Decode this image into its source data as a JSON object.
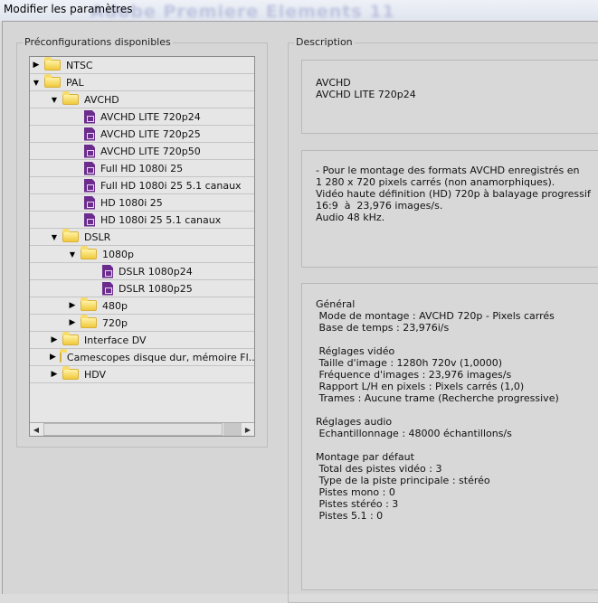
{
  "window": {
    "title": "Modifier les paramètres",
    "background_title": "Adobe Premiere Elements 11"
  },
  "presets": {
    "legend": "Préconfigurations disponibles",
    "items": [
      {
        "label": "NTSC",
        "level": 0,
        "type": "folder",
        "state": "collapsed"
      },
      {
        "label": "PAL",
        "level": 0,
        "type": "folder",
        "state": "expanded"
      },
      {
        "label": "AVCHD",
        "level": 1,
        "type": "folder",
        "state": "expanded"
      },
      {
        "label": "AVCHD LITE 720p24",
        "level": 2,
        "type": "preset"
      },
      {
        "label": "AVCHD LITE 720p25",
        "level": 2,
        "type": "preset"
      },
      {
        "label": "AVCHD LITE 720p50",
        "level": 2,
        "type": "preset"
      },
      {
        "label": "Full HD 1080i 25",
        "level": 2,
        "type": "preset"
      },
      {
        "label": "Full HD 1080i 25 5.1 canaux",
        "level": 2,
        "type": "preset"
      },
      {
        "label": "HD 1080i 25",
        "level": 2,
        "type": "preset"
      },
      {
        "label": "HD 1080i 25 5.1 canaux",
        "level": 2,
        "type": "preset"
      },
      {
        "label": "DSLR",
        "level": 1,
        "type": "folder",
        "state": "expanded"
      },
      {
        "label": "1080p",
        "level": 2,
        "type": "folder",
        "state": "expanded"
      },
      {
        "label": "DSLR 1080p24",
        "level": 3,
        "type": "preset"
      },
      {
        "label": "DSLR 1080p25",
        "level": 3,
        "type": "preset"
      },
      {
        "label": "480p",
        "level": 2,
        "type": "folder",
        "state": "collapsed"
      },
      {
        "label": "720p",
        "level": 2,
        "type": "folder",
        "state": "collapsed"
      },
      {
        "label": "Interface DV",
        "level": 1,
        "type": "folder",
        "state": "collapsed"
      },
      {
        "label": "Camescopes disque dur, mémoire Fl...",
        "level": 1,
        "type": "folder",
        "state": "collapsed"
      },
      {
        "label": "HDV",
        "level": 1,
        "type": "folder",
        "state": "collapsed"
      }
    ]
  },
  "description": {
    "legend": "Description",
    "name_lines": [
      "AVCHD",
      "AVCHD LITE 720p24"
    ],
    "summary_lines": [
      "- Pour le montage des formats AVCHD enregistrés en",
      "1 280 x 720 pixels carrés (non anamorphiques).",
      "Vidéo haute définition (HD) 720p à balayage progressif",
      "16:9  à  23,976 images/s.",
      "Audio 48 kHz."
    ],
    "details_lines": [
      "Général",
      " Mode de montage : AVCHD 720p - Pixels carrés",
      " Base de temps : 23,976i/s",
      "",
      " Réglages vidéo",
      " Taille d'image : 1280h 720v (1,0000)",
      " Fréquence d'images : 23,976 images/s",
      " Rapport L/H en pixels : Pixels carrés (1,0)",
      " Trames : Aucune trame (Recherche progressive)",
      "",
      "Réglages audio",
      " Echantillonnage : 48000 échantillons/s",
      "",
      "Montage par défaut",
      " Total des pistes vidéo : 3",
      " Type de la piste principale : stéréo",
      " Pistes mono : 0",
      " Pistes stéréo : 3",
      " Pistes 5.1 : 0"
    ]
  }
}
